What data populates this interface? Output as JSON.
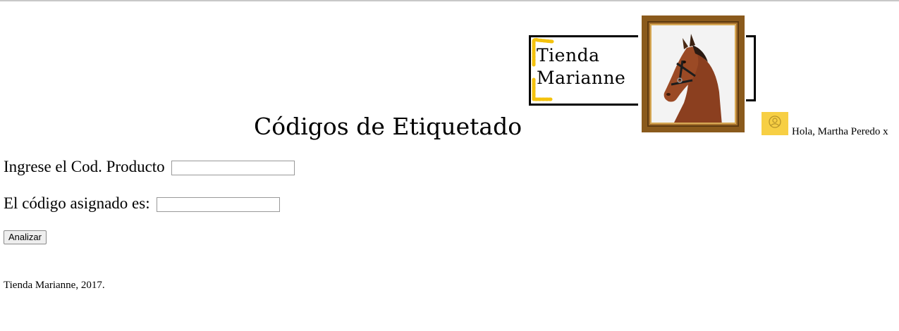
{
  "header": {
    "logo_line1": "Tienda",
    "logo_line2": "Marianne",
    "logo_image": "horse-portrait",
    "frame_color": "#8a5a1c",
    "accent_color": "#f4c20d"
  },
  "page_title": "Códigos de Etiquetado",
  "user": {
    "avatar_icon": "user-circle-icon",
    "avatar_color": "#f7cf44",
    "greeting": "Hola, Martha Peredo x"
  },
  "form": {
    "product_label": "Ingrese el Cod. Producto",
    "product_value": "",
    "code_label": "El código asignado es:",
    "code_value": "",
    "analyze_button": "Analizar"
  },
  "footer": {
    "text": "Tienda Marianne, 2017."
  }
}
